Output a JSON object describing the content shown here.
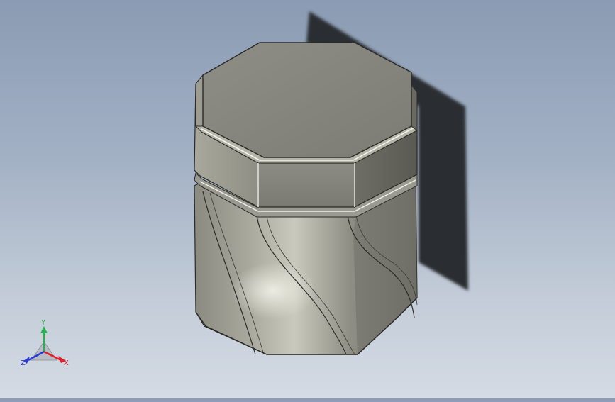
{
  "viewport": {
    "background_top": "#8a9bb3",
    "background_bottom": "#d4dbe4",
    "model": "octagonal-jar-with-lid"
  },
  "triad": {
    "x_label": "X",
    "y_label": "Y",
    "z_label": "Z",
    "x_color": "#e0202a",
    "y_color": "#22b14c",
    "z_color": "#2a3ad8"
  }
}
